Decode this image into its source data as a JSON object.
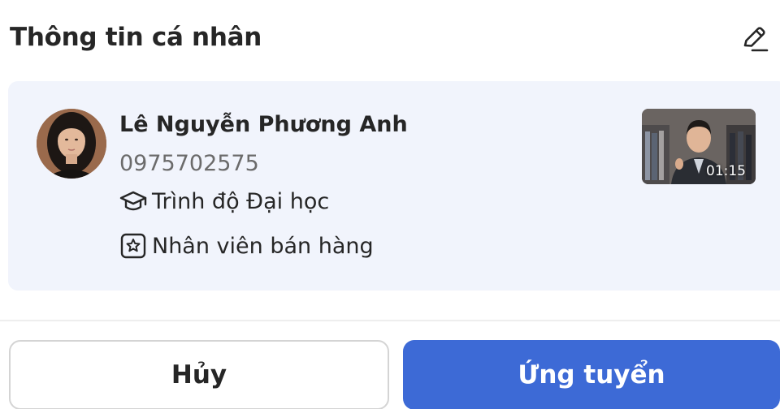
{
  "header": {
    "title": "Thông tin cá nhân",
    "edit_icon": "pencil-icon"
  },
  "profile": {
    "name": "Lê Nguyễn Phương Anh",
    "phone": "0975702575",
    "education": "Trình độ Đại học",
    "education_icon": "graduation-cap-icon",
    "position": "Nhân viên bán hàng",
    "position_icon": "star-badge-icon",
    "video": {
      "duration": "01:15"
    }
  },
  "actions": {
    "cancel_label": "Hủy",
    "apply_label": "Ứng tuyển"
  },
  "colors": {
    "card_background": "#f1f4fc",
    "primary": "#3d6ad6",
    "text": "#262626",
    "muted_text": "#6b6b6b"
  }
}
